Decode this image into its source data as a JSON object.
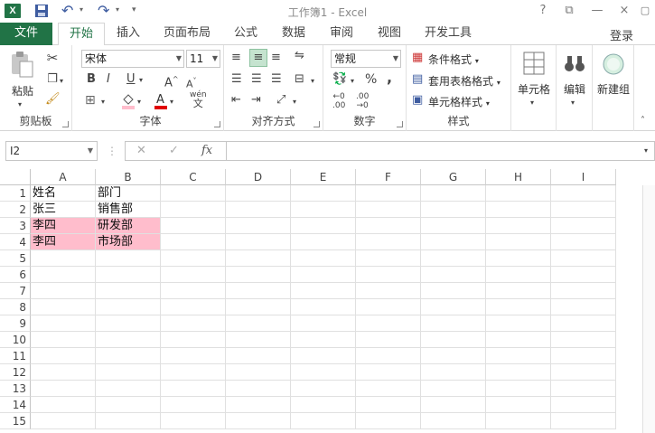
{
  "window": {
    "title": "工作簿1 - Excel",
    "help": "?",
    "restore": "⧉",
    "minimize": "—",
    "close": "×",
    "quick_access": {
      "logo": "X",
      "save_icon": "save-icon",
      "undo": "↶",
      "redo": "↷",
      "customize": "▾"
    }
  },
  "tabs": [
    {
      "label": "文件"
    },
    {
      "label": "开始"
    },
    {
      "label": "插入"
    },
    {
      "label": "页面布局"
    },
    {
      "label": "公式"
    },
    {
      "label": "数据"
    },
    {
      "label": "审阅"
    },
    {
      "label": "视图"
    },
    {
      "label": "开发工具"
    }
  ],
  "login_label": "登录",
  "ribbon": {
    "clipboard": {
      "label": "剪贴板",
      "paste_label": "粘贴"
    },
    "font": {
      "label": "字体",
      "font_name": "宋体",
      "font_size": "11",
      "bold": "B",
      "italic": "I",
      "underline": "U",
      "grow": "A",
      "shrink": "A",
      "wen": "wén"
    },
    "alignment": {
      "label": "对齐方式"
    },
    "number": {
      "label": "数字",
      "format": "常规",
      "percent": "%",
      "comma": ","
    },
    "styles": {
      "label": "样式",
      "conditional": "条件格式",
      "table_format": "套用表格格式",
      "cell_styles": "单元格样式"
    },
    "cells": {
      "label": "单元格"
    },
    "editing": {
      "label": "编辑"
    },
    "new_group": {
      "label": "新建组"
    }
  },
  "formula_bar": {
    "name_box": "I2",
    "cancel": "✕",
    "enter": "✓",
    "fx": "fx",
    "formula": ""
  },
  "sheet": {
    "columns": [
      "A",
      "B",
      "C",
      "D",
      "E",
      "F",
      "G",
      "H",
      "I"
    ],
    "rows": [
      "1",
      "2",
      "3",
      "4",
      "5",
      "6",
      "7",
      "8",
      "9",
      "10",
      "11",
      "12",
      "13",
      "14",
      "15"
    ],
    "cells": {
      "A1": "姓名",
      "B1": "部门",
      "A2": "张三",
      "B2": "销售部",
      "A3": "李四",
      "B3": "研发部",
      "A4": "李四",
      "B4": "市场部"
    },
    "highlight_color": "#ffbdcc",
    "highlighted_rows": [
      "3",
      "4"
    ]
  },
  "colors": {
    "accent": "#217346"
  }
}
